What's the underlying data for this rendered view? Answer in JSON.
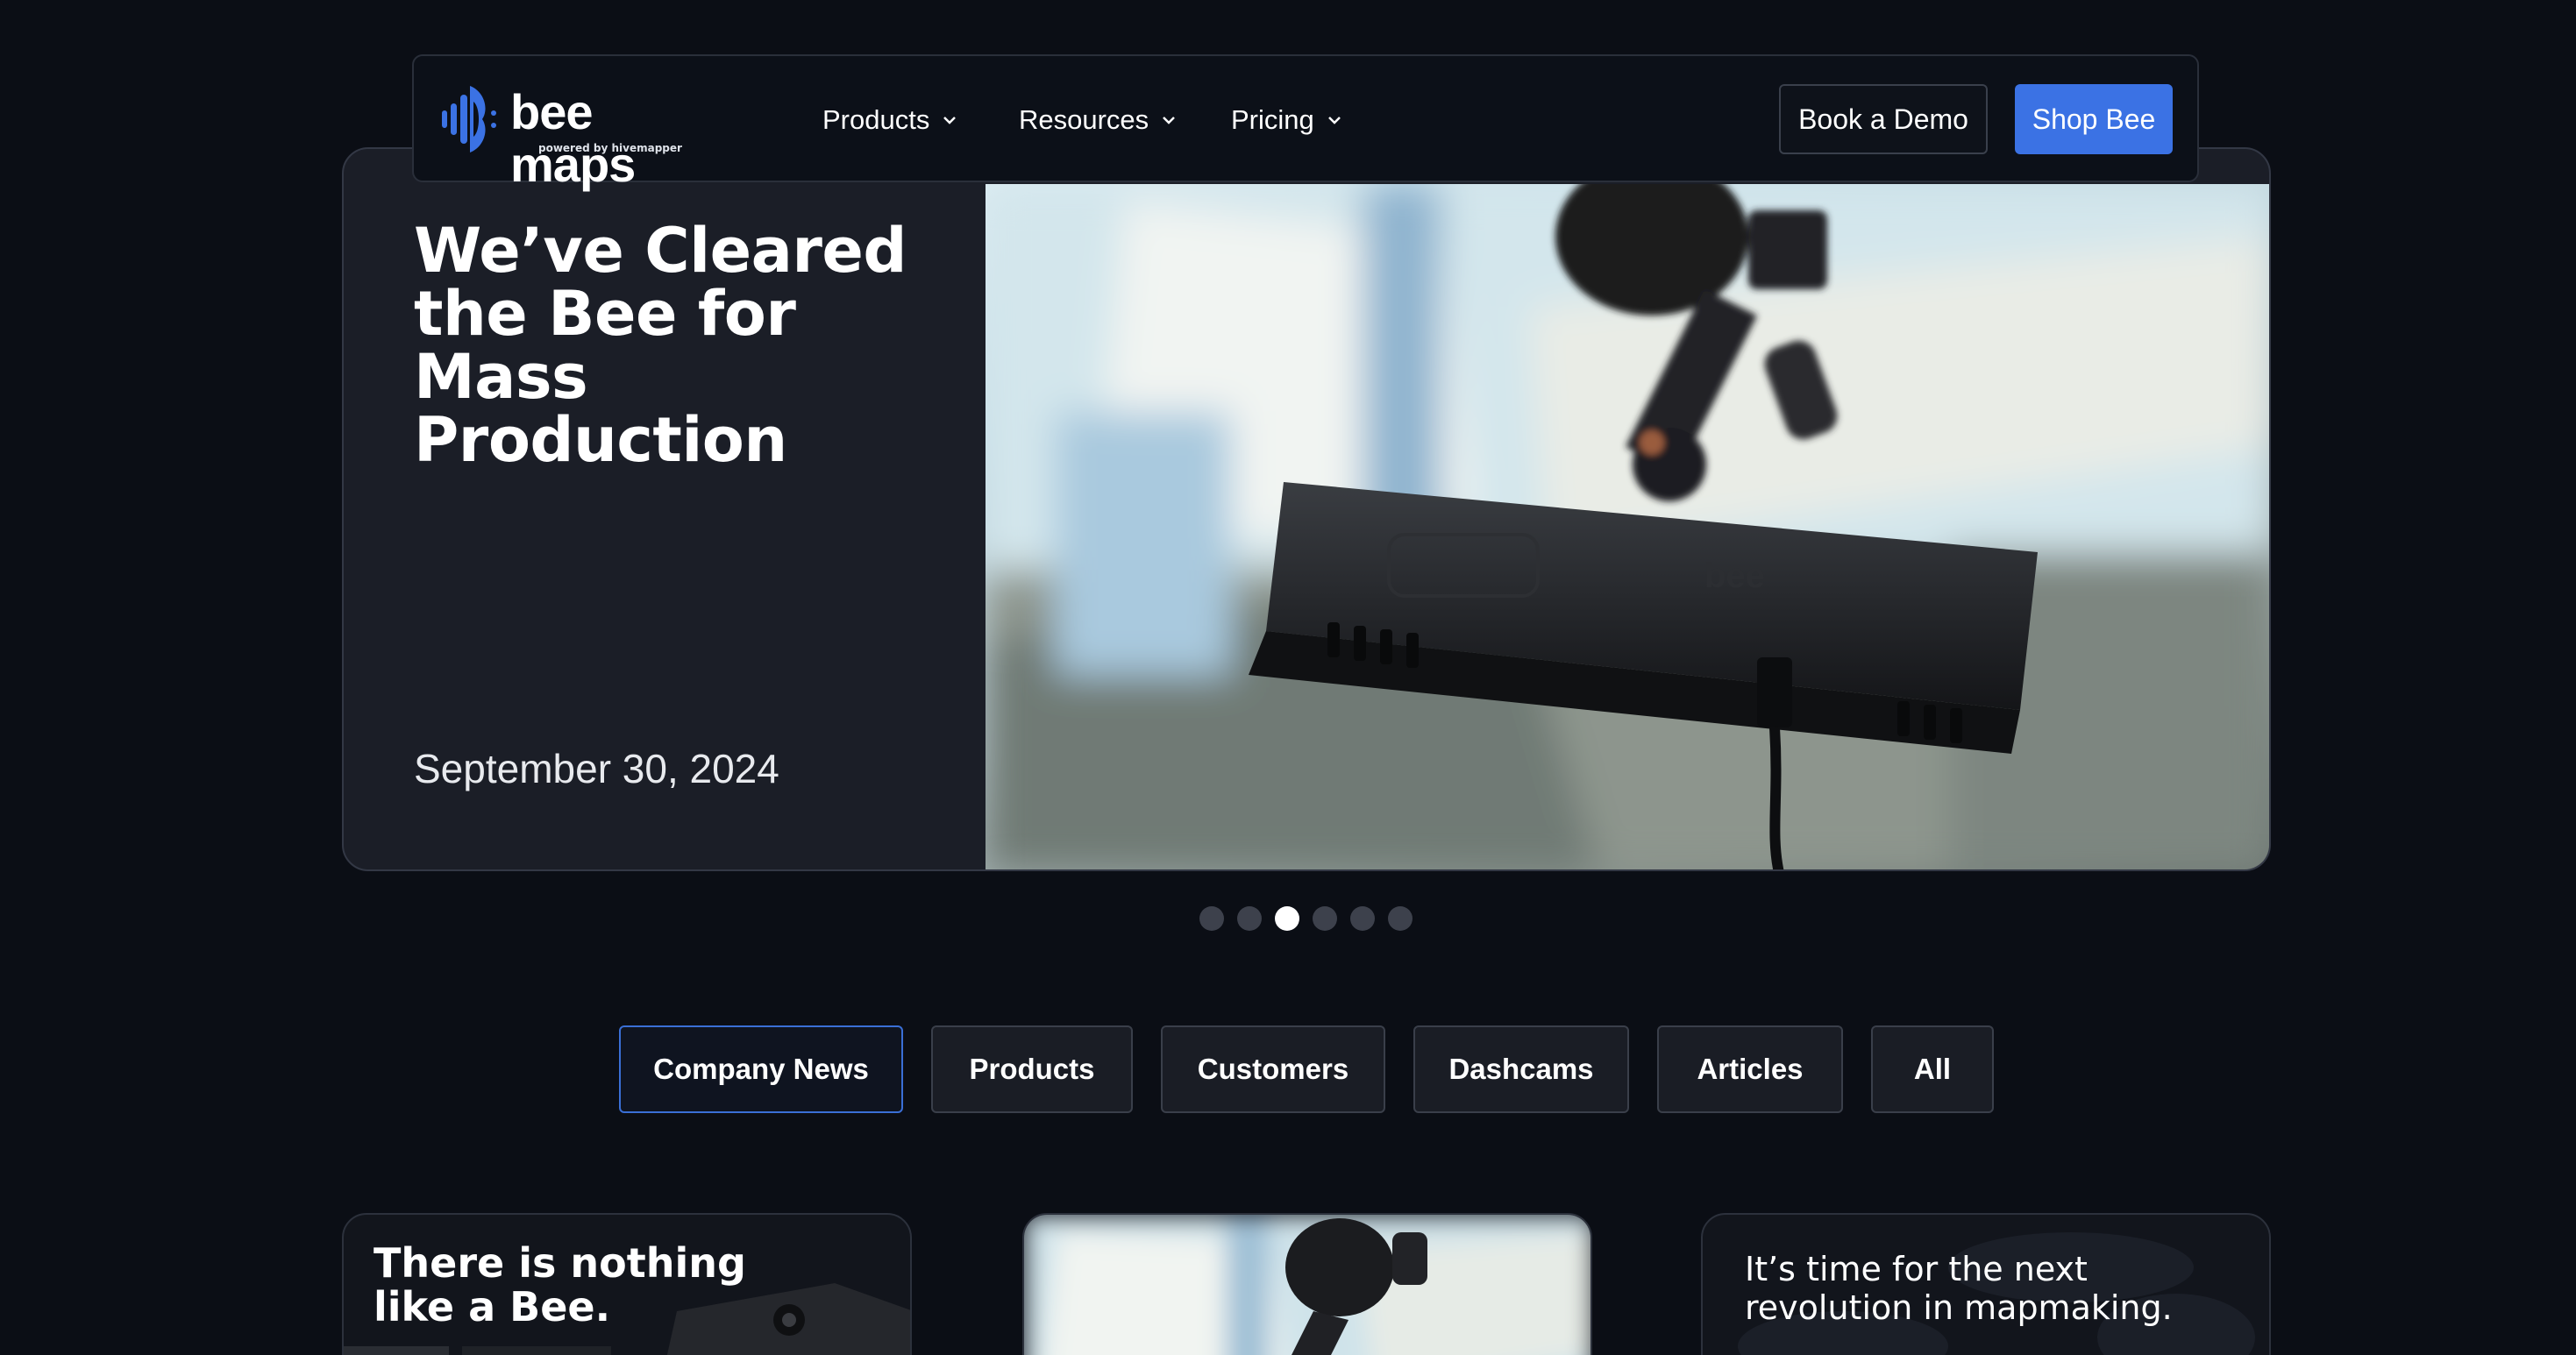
{
  "brand": {
    "name": "bee maps",
    "tagline": "powered by hivemapper",
    "logo_icon": "bee-waveform-icon",
    "accent": "#3b72e4"
  },
  "nav": {
    "items": [
      {
        "label": "Products",
        "icon": "chevron-down-icon"
      },
      {
        "label": "Resources",
        "icon": "chevron-down-icon"
      },
      {
        "label": "Pricing",
        "icon": "chevron-down-icon"
      }
    ],
    "demo_label": "Book a Demo",
    "shop_label": "Shop Bee"
  },
  "hero": {
    "title": "We’ve Cleared the Bee for Mass Production",
    "date": "September 30, 2024",
    "image": "Bee dashcam mounted on windshield"
  },
  "carousel": {
    "count": 6,
    "active_index": 2
  },
  "filters": [
    {
      "label": "Company News",
      "active": true
    },
    {
      "label": "Products",
      "active": false
    },
    {
      "label": "Customers",
      "active": false
    },
    {
      "label": "Dashcams",
      "active": false
    },
    {
      "label": "Articles",
      "active": false
    },
    {
      "label": "All",
      "active": false
    }
  ],
  "cards": [
    {
      "title": "There is nothing\nlike a Bee."
    },
    {
      "title": ""
    },
    {
      "title": "It’s time for the next\nrevolution in mapmaking."
    }
  ]
}
